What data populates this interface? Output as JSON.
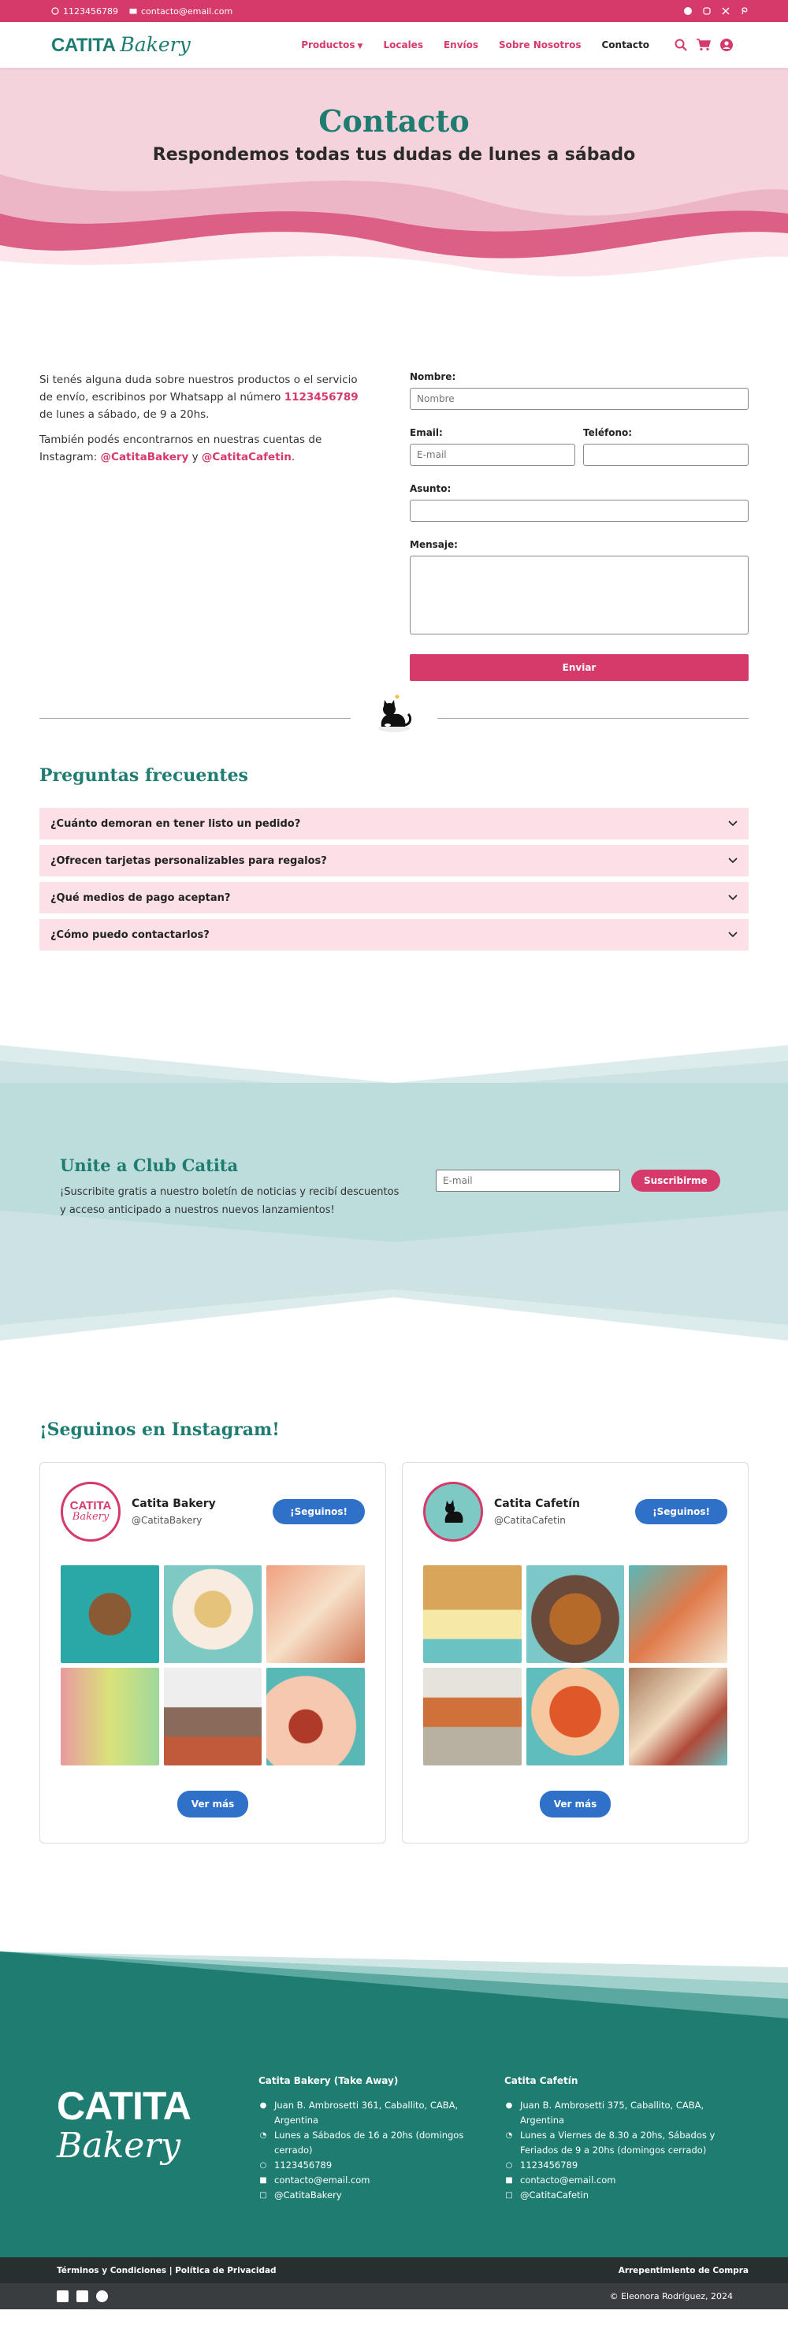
{
  "topbar": {
    "phone": "1123456789",
    "email": "contacto@email.com",
    "socials": [
      "facebook-icon",
      "instagram-icon",
      "x-icon",
      "pinterest-icon"
    ]
  },
  "nav": {
    "logo_main": "CATITA",
    "logo_script": "Bakery",
    "links": [
      "Productos",
      "Locales",
      "Envíos",
      "Sobre Nosotros",
      "Contacto"
    ],
    "active": "Contacto"
  },
  "hero": {
    "title": "Contacto",
    "subtitle": "Respondemos todas tus dudas de lunes a sábado"
  },
  "contact": {
    "p1_a": "Si tenés alguna duda sobre nuestros productos o el servicio de envío, escribinos por Whatsapp al número ",
    "p1_phone": "1123456789",
    "p1_b": " de lunes a sábado, de 9 a 20hs.",
    "p2_a": "También podés encontrarnos en nuestras cuentas de Instagram: ",
    "p2_ig1": "@CatitaBakery",
    "p2_and": " y ",
    "p2_ig2": "@CatitaCafetin",
    "p2_end": "."
  },
  "form": {
    "name_label": "Nombre:",
    "name_placeholder": "Nombre",
    "email_label": "Email:",
    "email_placeholder": "E-mail",
    "phone_label": "Teléfono:",
    "subject_label": "Asunto:",
    "message_label": "Mensaje:",
    "submit": "Enviar"
  },
  "faq": {
    "title": "Preguntas frecuentes",
    "items": [
      "¿Cuánto demoran en tener listo un pedido?",
      "¿Ofrecen tarjetas personalizables para regalos?",
      "¿Qué medios de pago aceptan?",
      "¿Cómo puedo contactarlos?"
    ]
  },
  "club": {
    "title": "Unite a Club Catita",
    "text": "¡Suscribite gratis a nuestro boletín de noticias y recibí descuentos y acceso anticipado a nuestros nuevos lanzamientos!",
    "placeholder": "E-mail",
    "button": "Suscribirme"
  },
  "instagram": {
    "title": "¡Seguinos en Instagram!",
    "cards": [
      {
        "name": "Catita Bakery",
        "handle": "@CatitaBakery",
        "follow": "¡Seguinos!",
        "more": "Ver más",
        "avatar_text": "CATITA",
        "avatar_script": "Bakery"
      },
      {
        "name": "Catita Cafetín",
        "handle": "@CatitaCafetin",
        "follow": "¡Seguinos!",
        "more": "Ver más"
      }
    ]
  },
  "footer": {
    "logo_main": "CATITA",
    "logo_script": "Bakery",
    "col1": {
      "title": "Catita Bakery (Take Away)",
      "address": "Juan B. Ambrosetti 361, Caballito, CABA, Argentina",
      "hours": "Lunes a Sábados de 16 a 20hs (domingos cerrado)",
      "phone": "1123456789",
      "email": "contacto@email.com",
      "ig": "@CatitaBakery"
    },
    "col2": {
      "title": "Catita Cafetín",
      "address": "Juan B. Ambrosetti 375, Caballito, CABA, Argentina",
      "hours": "Lunes a Viernes de 8.30 a 20hs, Sábados y Feriados de 9 a 20hs (domingos cerrado)",
      "phone": "1123456789",
      "email": "contacto@email.com",
      "ig": "@CatitaCafetin"
    },
    "terms": "Términos y Condiciones | Política de Privacidad",
    "regret": "Arrepentimiento de Compra",
    "copyright": "© Eleonora Rodríguez, 2024"
  },
  "colors": {
    "brand_pink": "#d63a6a",
    "brand_teal": "#1e7c70",
    "button_blue": "#2f70c9"
  }
}
